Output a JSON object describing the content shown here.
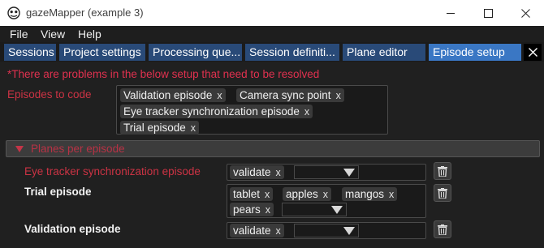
{
  "window": {
    "title": "gazeMapper (example 3)",
    "minimize_icon": "minimize-icon",
    "maximize_icon": "maximize-icon",
    "close_icon": "close-icon"
  },
  "menu": [
    "File",
    "View",
    "Help"
  ],
  "tabs": [
    {
      "label": "Sessions",
      "active": false
    },
    {
      "label": "Project settings",
      "active": false
    },
    {
      "label": "Processing que...",
      "active": false
    },
    {
      "label": "Session definiti...",
      "active": false
    },
    {
      "label": "Plane editor",
      "active": false
    },
    {
      "label": "Episode setup",
      "active": true
    }
  ],
  "colors": {
    "tab_active": "#3a77c4",
    "tab_inactive": "#294a78",
    "error_red": "#e0314f"
  },
  "episode_setup": {
    "warning": "*There are problems in the below setup that need to be resolved",
    "episodes_label": "Episodes to code",
    "episodes": [
      "Validation episode",
      "Camera sync point",
      "Eye tracker synchronization episode",
      "Trial episode"
    ],
    "chip_remove": "x",
    "planes_section_title": "Planes per episode",
    "planes": [
      {
        "episode": "Eye tracker synchronization episode",
        "has_error": true,
        "planes": [
          "validate"
        ]
      },
      {
        "episode": "Trial episode",
        "has_error": false,
        "planes": [
          "tablet",
          "apples",
          "mangos",
          "pears"
        ]
      },
      {
        "episode": "Validation episode",
        "has_error": false,
        "planes": [
          "validate"
        ]
      }
    ]
  }
}
